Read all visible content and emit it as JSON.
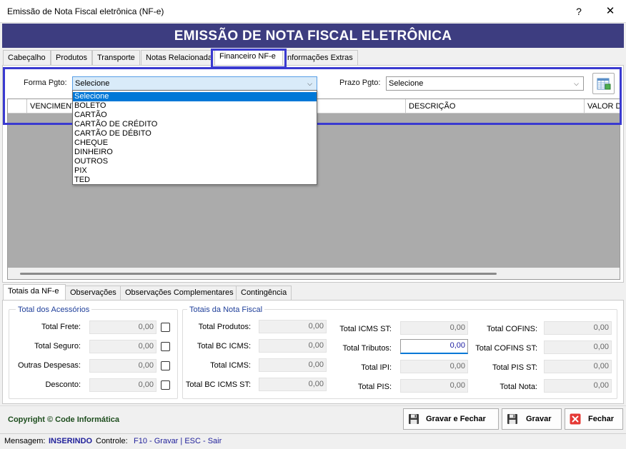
{
  "window": {
    "title": "Emissão de Nota Fiscal eletrônica (NF-e)",
    "help_glyph": "?",
    "close_glyph": "✕"
  },
  "banner": {
    "title": "EMISSÃO DE NOTA FISCAL ELETRÔNICA"
  },
  "tabs": [
    {
      "label": "Cabeçalho",
      "active": false
    },
    {
      "label": "Produtos",
      "active": false
    },
    {
      "label": "Transporte",
      "active": false
    },
    {
      "label": "Notas Relacionada",
      "active": false
    },
    {
      "label": "Financeiro NF-e",
      "active": true
    },
    {
      "label": "Informações Extras",
      "active": false
    }
  ],
  "financeiro": {
    "forma_label": "Forma Pgto:",
    "forma_value": "Selecione",
    "prazo_label": "Prazo Pgto:",
    "prazo_value": "Selecione",
    "grid_columns": [
      "VENCIMENTO",
      "DESCRIÇÃO",
      "VALOR DO"
    ],
    "dropdown_options": [
      "Selecione",
      "BOLETO",
      "CARTÃO",
      "CARTÃO DE CRÉDITO",
      "CARTÃO DE DÉBITO",
      "CHEQUE",
      "DINHEIRO",
      "OUTROS",
      "PIX",
      "TED"
    ],
    "dropdown_selected": "Selecione"
  },
  "bottom_tabs": [
    {
      "label": "Totais da NF-e",
      "active": true
    },
    {
      "label": "Observações",
      "active": false
    },
    {
      "label": "Observações Complementares",
      "active": false
    },
    {
      "label": "Contingência",
      "active": false
    }
  ],
  "acessorios": {
    "title": "Total dos Acessórios",
    "rows": [
      {
        "label": "Total Frete:",
        "value": "0,00"
      },
      {
        "label": "Total Seguro:",
        "value": "0,00"
      },
      {
        "label": "Outras Despesas:",
        "value": "0,00"
      },
      {
        "label": "Desconto:",
        "value": "0,00"
      }
    ]
  },
  "nota_fiscal": {
    "title": "Totais da Nota Fiscal",
    "col1": [
      {
        "label": "Total Produtos:",
        "value": "0,00"
      },
      {
        "label": "Total BC ICMS:",
        "value": "0,00"
      },
      {
        "label": "Total ICMS:",
        "value": "0,00"
      },
      {
        "label": "Total BC ICMS ST:",
        "value": "0,00"
      }
    ],
    "col2": [
      {
        "label": "Total ICMS ST:",
        "value": "0,00"
      },
      {
        "label": "Total Tributos:",
        "value": "0,00"
      },
      {
        "label": "Total IPI:",
        "value": "0,00"
      },
      {
        "label": "Total PIS:",
        "value": "0,00"
      }
    ],
    "col3": [
      {
        "label": "Total COFINS:",
        "value": "0,00"
      },
      {
        "label": "Total COFINS ST:",
        "value": "0,00"
      },
      {
        "label": "Total PIS ST:",
        "value": "0,00"
      },
      {
        "label": "Total Nota:",
        "value": "0,00"
      }
    ]
  },
  "footer": {
    "copyright": "Copyright © Code Informática",
    "buttons": {
      "save_close": "Gravar e Fechar",
      "save": "Gravar",
      "close": "Fechar"
    }
  },
  "status": {
    "msg_label": "Mensagem:",
    "msg_value": "INSERINDO",
    "ctrl_label": "Controle:",
    "ctrl_value": "F10 - Gravar | ESC - Sair"
  },
  "colors": {
    "banner": "#3d3d80",
    "highlight": "#3a3ad0",
    "selection": "#0078d7",
    "group_title": "#1f3f9a",
    "status_value": "#1f1f9a"
  },
  "icons": {
    "prazo_button": "calendar-grid-icon",
    "save_close": "floppy-disk-icon",
    "save": "floppy-disk-icon",
    "close": "red-x-icon"
  }
}
